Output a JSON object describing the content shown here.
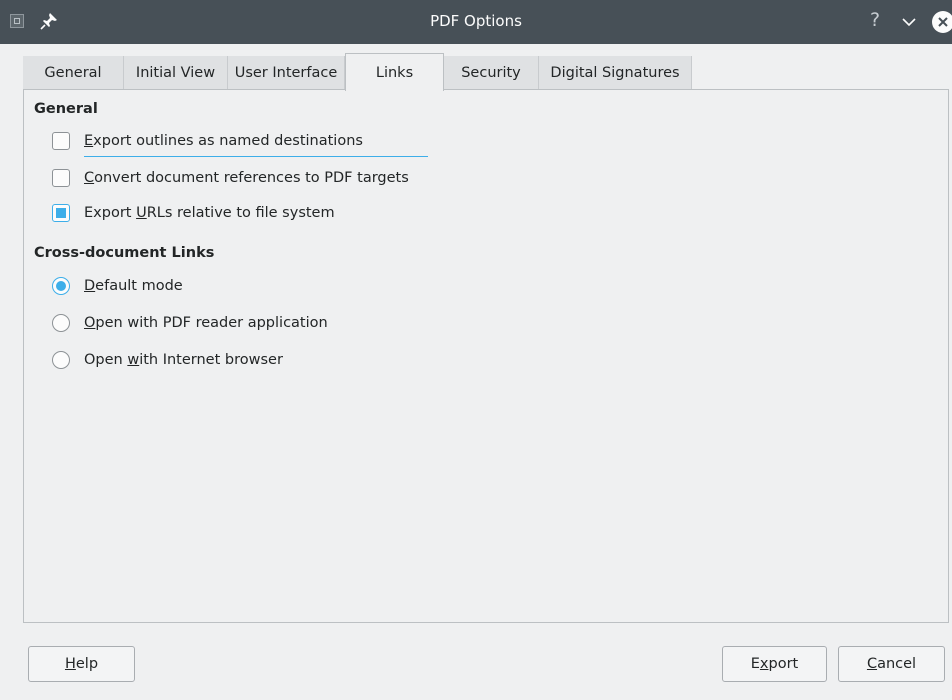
{
  "window": {
    "title": "PDF Options",
    "help_glyph": "?",
    "icons": [
      "app-icon",
      "pin-icon",
      "help-icon",
      "chevron-down-icon",
      "close-icon"
    ]
  },
  "tabs": [
    {
      "label": "General",
      "active": false
    },
    {
      "label": "Initial View",
      "active": false
    },
    {
      "label": "User Interface",
      "active": false
    },
    {
      "label": "Links",
      "active": true
    },
    {
      "label": "Security",
      "active": false
    },
    {
      "label": "Digital Signatures",
      "active": false
    }
  ],
  "general": {
    "title": "General",
    "options": [
      {
        "mnemonic": "E",
        "rest": "xport outlines as named destinations",
        "checked": false
      },
      {
        "mnemonic": "C",
        "rest": "onvert document references to PDF targets",
        "checked": false
      },
      {
        "pre": "Export ",
        "mnemonic": "U",
        "rest": "RLs relative to file system",
        "checked": true
      }
    ]
  },
  "cross": {
    "title": "Cross-document Links",
    "options": [
      {
        "mnemonic": "D",
        "rest": "efault mode",
        "selected": true
      },
      {
        "mnemonic": "O",
        "rest": "pen with PDF reader application",
        "selected": false
      },
      {
        "pre": "Open ",
        "mnemonic": "w",
        "rest": "ith Internet browser",
        "selected": false
      }
    ]
  },
  "buttons": {
    "help": {
      "mnemonic": "H",
      "rest": "elp"
    },
    "export": {
      "pre": "E",
      "mnemonic": "x",
      "rest": "port"
    },
    "cancel": {
      "mnemonic": "C",
      "rest": "ancel"
    }
  },
  "colors": {
    "accent": "#3daee9",
    "titlebar": "#475057",
    "background": "#eff0f1"
  }
}
